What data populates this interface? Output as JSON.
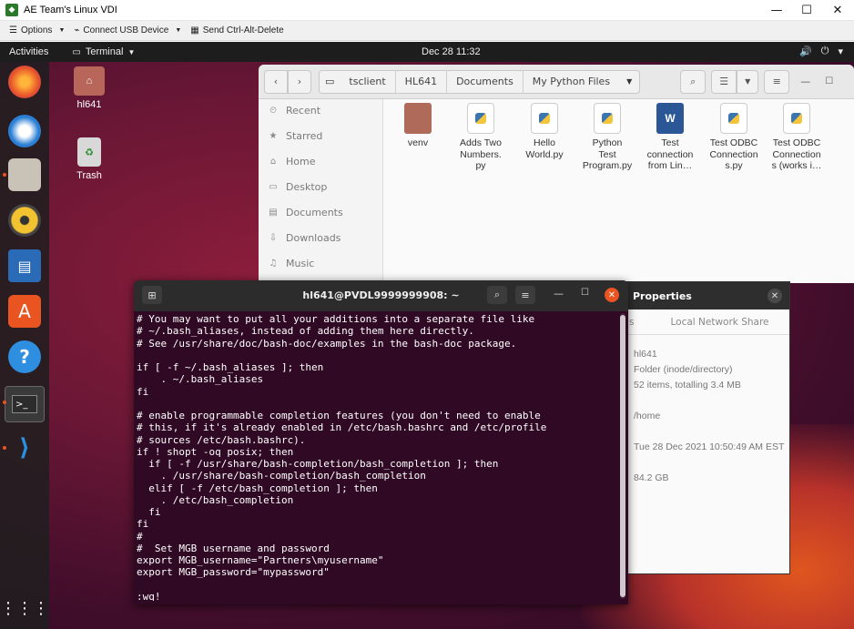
{
  "host": {
    "title": "AE Team's Linux VDI",
    "controls": [
      "—",
      "☐",
      "✕"
    ],
    "toolbar": {
      "options": "Options",
      "usb": "Connect USB Device",
      "cad": "Send Ctrl-Alt-Delete"
    }
  },
  "topbar": {
    "activities": "Activities",
    "app": "Terminal",
    "clock": "Dec 28  11:32",
    "tray": [
      "🔊",
      "⏻",
      "▾"
    ]
  },
  "desktop_icons": [
    {
      "label": "hl641"
    },
    {
      "label": "Trash"
    }
  ],
  "files": {
    "path": [
      "tsclient",
      "HL641",
      "Documents",
      "My Python Files"
    ],
    "sidebar": [
      {
        "label": "Recent",
        "icon": "⏲"
      },
      {
        "label": "Starred",
        "icon": "★"
      },
      {
        "label": "Home",
        "icon": "⌂"
      },
      {
        "label": "Desktop",
        "icon": "▭"
      },
      {
        "label": "Documents",
        "icon": "▤"
      },
      {
        "label": "Downloads",
        "icon": "⇩"
      },
      {
        "label": "Music",
        "icon": "♫"
      }
    ],
    "items": [
      {
        "line1": "venv",
        "line2": "",
        "line3": ""
      },
      {
        "line1": "Adds Two",
        "line2": "Numbers.",
        "line3": "py"
      },
      {
        "line1": "Hello",
        "line2": "World.py",
        "line3": ""
      },
      {
        "line1": "Python",
        "line2": "Test",
        "line3": "Program.py"
      },
      {
        "line1": "Test",
        "line2": "connection",
        "line3": "from Lin…"
      },
      {
        "line1": "Test ODBC",
        "line2": "Connection",
        "line3": "s.py"
      },
      {
        "line1": "Test ODBC",
        "line2": "Connection",
        "line3": "s (works i…"
      }
    ]
  },
  "properties": {
    "title": "Properties",
    "tabs": [
      "s",
      "Local Network Share"
    ],
    "values": [
      "hl641",
      "Folder (inode/directory)",
      "52 items, totalling 3.4 MB",
      "/home",
      "Tue 28 Dec 2021 10:50:49 AM EST",
      "84.2 GB"
    ]
  },
  "terminal": {
    "title": "hl641@PVDL9999999908: ~",
    "lines": [
      "# You may want to put all your additions into a separate file like",
      "# ~/.bash_aliases, instead of adding them here directly.",
      "# See /usr/share/doc/bash-doc/examples in the bash-doc package.",
      "",
      "if [ -f ~/.bash_aliases ]; then",
      "    . ~/.bash_aliases",
      "fi",
      "",
      "# enable programmable completion features (you don't need to enable",
      "# this, if it's already enabled in /etc/bash.bashrc and /etc/profile",
      "# sources /etc/bash.bashrc).",
      "if ! shopt -oq posix; then",
      "  if [ -f /usr/share/bash-completion/bash_completion ]; then",
      "    . /usr/share/bash-completion/bash_completion",
      "  elif [ -f /etc/bash_completion ]; then",
      "    . /etc/bash_completion",
      "  fi",
      "fi",
      "#",
      "#  Set MGB username and password",
      "export MGB_username=\"Partners\\myusername\"",
      "export MGB_password=\"mypassword\"",
      "",
      ":wq!"
    ]
  }
}
